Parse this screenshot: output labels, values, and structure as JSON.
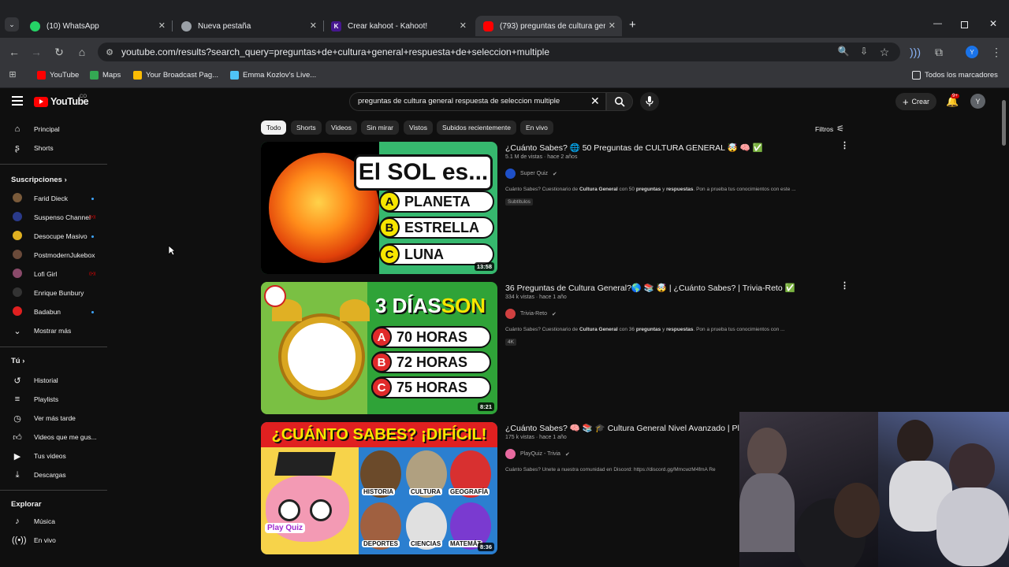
{
  "browser": {
    "tabs": [
      {
        "title": "(10) WhatsApp",
        "icon": "whatsapp-icon",
        "color": "#25d366"
      },
      {
        "title": "Nueva pestaña",
        "icon": "chrome-icon",
        "color": "#9aa0a6"
      },
      {
        "title": "Crear kahoot - Kahoot!",
        "icon": "kahoot-icon",
        "color": "#46178f"
      },
      {
        "title": "(793) preguntas de cultura gene",
        "icon": "youtube-icon",
        "color": "#ff0000"
      }
    ],
    "url": "youtube.com/results?search_query=preguntas+de+cultura+general+respuesta+de+seleccion+multiple",
    "profile_initial": "Y",
    "bookmarks": [
      {
        "label": "YouTube",
        "color": "#ff0000"
      },
      {
        "label": "Maps",
        "color": "#34a853"
      },
      {
        "label": "Your Broadcast Pag...",
        "color": "#fbbc04"
      },
      {
        "label": "Emma Kozlov's Live...",
        "color": "#4fc3f7"
      }
    ],
    "all_bookmarks": "Todos los marcadores"
  },
  "youtube": {
    "logo_text": "YouTube",
    "country": "CO",
    "search_query": "preguntas de cultura general respuesta de seleccion multiple",
    "create_label": "Crear",
    "notif_count": "9+",
    "avatar_initial": "Y",
    "sidebar": {
      "main": [
        {
          "label": "Principal",
          "icon": "home-icon"
        },
        {
          "label": "Shorts",
          "icon": "shorts-icon"
        }
      ],
      "subs_title": "Suscripciones",
      "subs": [
        {
          "label": "Farid Dieck",
          "color": "#7a5a3a",
          "status": "dot"
        },
        {
          "label": "Suspenso Channel",
          "color": "#2a3a8a",
          "status": "live"
        },
        {
          "label": "Desocupe Masivo",
          "color": "#e0b020",
          "status": "dot"
        },
        {
          "label": "PostmodernJukebox",
          "color": "#6a4a3a",
          "status": "none"
        },
        {
          "label": "Lofi Girl",
          "color": "#8a4a6a",
          "status": "live"
        },
        {
          "label": "Enrique Bunbury",
          "color": "#333333",
          "status": "none"
        },
        {
          "label": "Badabun",
          "color": "#e02020",
          "status": "dot"
        }
      ],
      "show_more": "Mostrar más",
      "you_title": "Tú",
      "you": [
        {
          "label": "Historial",
          "icon": "history-icon"
        },
        {
          "label": "Playlists",
          "icon": "playlist-icon"
        },
        {
          "label": "Ver más tarde",
          "icon": "clock-icon"
        },
        {
          "label": "Videos que me gus...",
          "icon": "thumb-up-icon"
        },
        {
          "label": "Tus videos",
          "icon": "video-icon"
        },
        {
          "label": "Descargas",
          "icon": "download-icon"
        }
      ],
      "explore_title": "Explorar",
      "explore": [
        {
          "label": "Música",
          "icon": "music-icon"
        },
        {
          "label": "En vivo",
          "icon": "live-icon"
        }
      ]
    },
    "chips": [
      "Todo",
      "Shorts",
      "Videos",
      "Sin mirar",
      "Vistos",
      "Subidos recientemente",
      "En vivo"
    ],
    "filters_label": "Filtros",
    "videos": [
      {
        "title": "¿Cuánto Sabes? 🌐 50 Preguntas de CULTURA GENERAL 🤯 🧠 ✅",
        "meta": "5.1 M de vistas · hace 2 años",
        "channel": "Super Quiz",
        "channel_color": "#1e50c8",
        "desc_pre": "Cuánto Sabes? Cuestionario de ",
        "desc_b1": "Cultura General",
        "desc_mid": " con 50 ",
        "desc_b2": "preguntas",
        "desc_mid2": " y ",
        "desc_b3": "respuestas",
        "desc_post": ". Pon a prueba tus conocimientos con este ...",
        "badge": "Subtítulos",
        "duration": "13:58",
        "thumb": {
          "headline": "El SOL es...",
          "options": [
            [
              "A",
              "PLANETA"
            ],
            [
              "B",
              "ESTRELLA"
            ],
            [
              "C",
              "LUNA"
            ]
          ]
        }
      },
      {
        "title": "36 Preguntas de Cultura General?🌎 📚 🤯 | ¿Cuánto Sabes? | Trivia-Reto ✅",
        "meta": "334 k vistas · hace 1 año",
        "channel": "Trivia-Reto",
        "channel_color": "#d04040",
        "desc_pre": "Cuánto Sabes? Cuestionario de ",
        "desc_b1": "Cultura General",
        "desc_mid": " con 36 ",
        "desc_b2": "preguntas",
        "desc_mid2": " y ",
        "desc_b3": "respuestas",
        "desc_post": ". Pon a prueba tus conocimientos con ...",
        "badge": "4K",
        "duration": "8:21",
        "thumb": {
          "headline_a": "3 DÍAS ",
          "headline_b": "SON",
          "options": [
            [
              "A",
              "70 HORAS"
            ],
            [
              "B",
              "72 HORAS"
            ],
            [
              "C",
              "75 HORAS"
            ]
          ]
        }
      },
      {
        "title": "¿Cuánto Sabes? 🧠 📚 🎓 Cultura General Nivel Avanzado | Pla",
        "meta": "175 k vistas · hace 1 año",
        "channel": "PlayQuiz - Trivia",
        "channel_color": "#e86aa0",
        "desc_pre": "Cuánto Sabes? Únete a nuestra comunidad en Discord: https://discord.gg/MmcwzM4fmA Re",
        "duration": "8:36",
        "thumb": {
          "headline": "¿CUÁNTO SABES? ¡DIFÍCIL!",
          "labels": [
            "HISTORIA",
            "CULTURA",
            "GEOGRAFÍA",
            "DEPORTES",
            "CIENCIAS",
            "MATEMÁT"
          ],
          "logo": "Play Quiz"
        }
      }
    ]
  }
}
